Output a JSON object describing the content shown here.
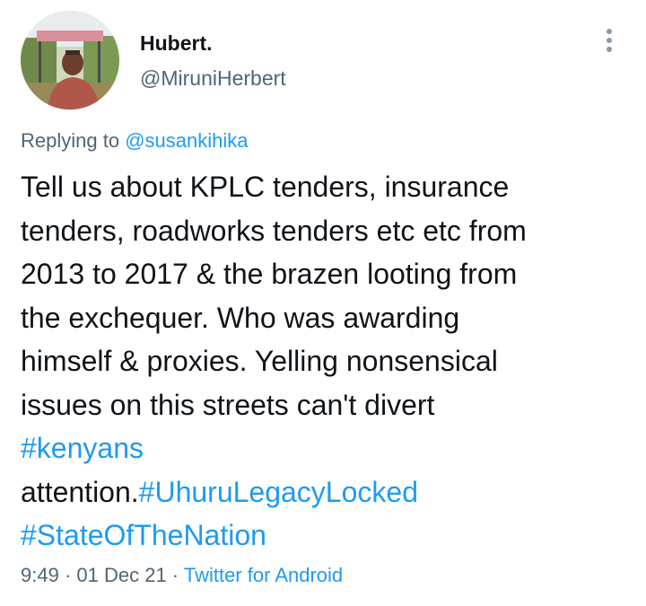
{
  "author": {
    "display_name": "Hubert.",
    "handle": "@MiruniHerbert"
  },
  "reply": {
    "prefix": "Replying to ",
    "mention": "@susankihika"
  },
  "tweet": {
    "lines": [
      "Tell us about KPLC tenders, insurance",
      "tenders, roadworks tenders etc etc from",
      "2013 to 2017 & the brazen looting from",
      "the exchequer. Who was awarding",
      "himself & proxies. Yelling nonsensical",
      "issues on this streets can't divert"
    ],
    "hashtag_kenyans": "#kenyans",
    "attention_text": "attention.",
    "hashtag_uhuru": "#UhuruLegacyLocked",
    "hashtag_nation": "#StateOfTheNation"
  },
  "meta": {
    "time": "9:49",
    "separator": " · ",
    "date": "01 Dec 21",
    "source": "Twitter for Android"
  },
  "colors": {
    "link": "#1d9bf0",
    "text": "#0f1419",
    "secondary": "#536471"
  },
  "icons": {
    "more": "more-vertical-icon",
    "avatar": "profile-photo"
  }
}
